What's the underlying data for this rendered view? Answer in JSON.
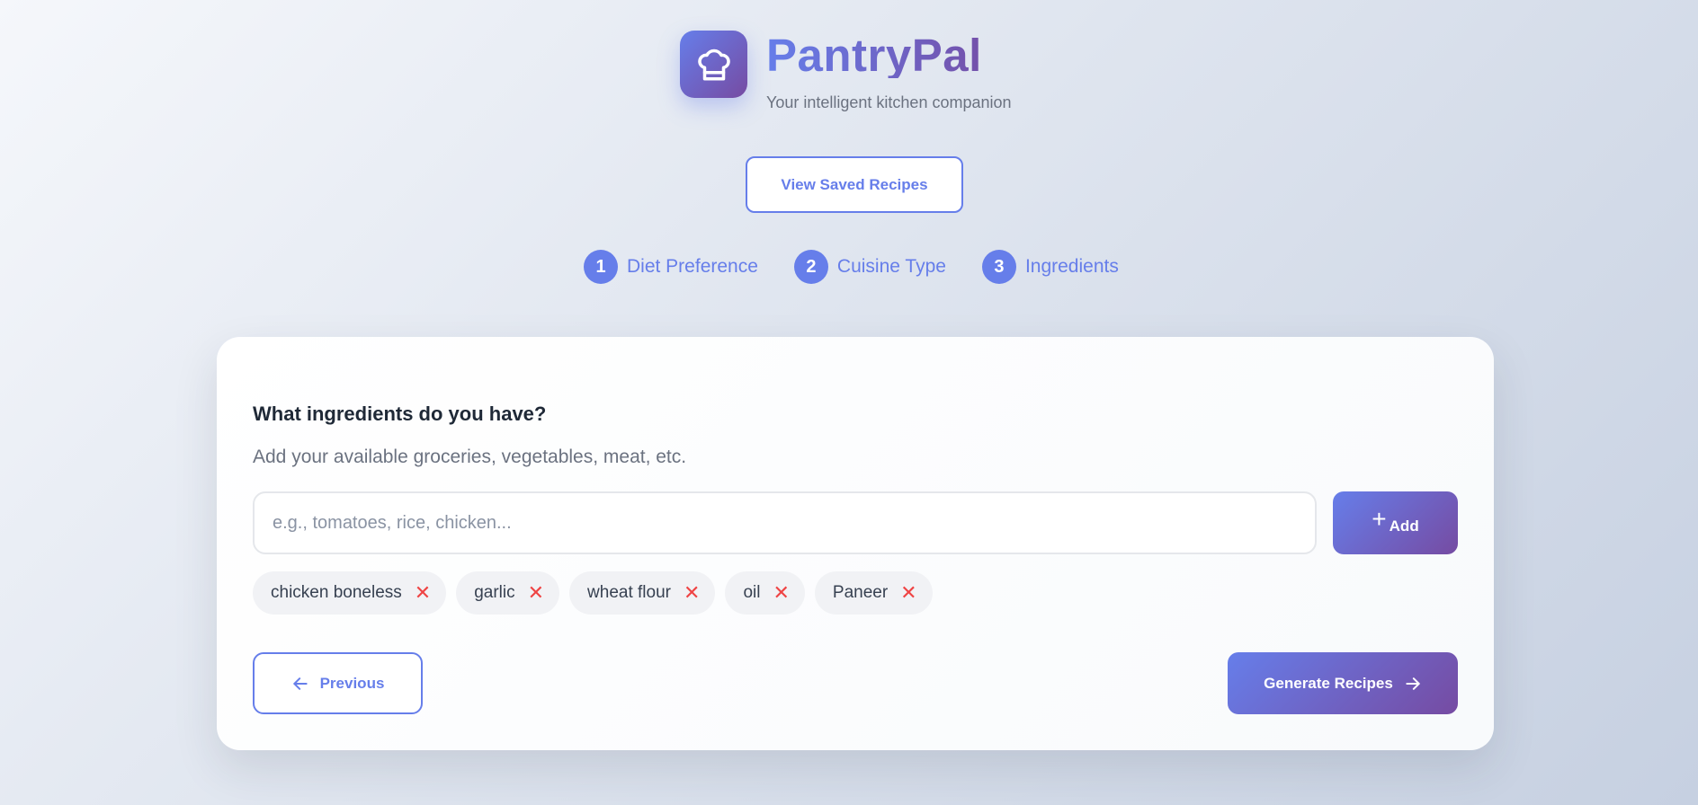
{
  "brand": {
    "title": "PantryPal",
    "subtitle": "Your intelligent kitchen companion",
    "logo_icon": "chef-hat-icon"
  },
  "saved_button": {
    "label": "View Saved Recipes"
  },
  "steps": [
    {
      "number": "1",
      "label": "Diet Preference"
    },
    {
      "number": "2",
      "label": "Cuisine Type"
    },
    {
      "number": "3",
      "label": "Ingredients"
    }
  ],
  "ingredients_step": {
    "title": "What ingredients do you have?",
    "subtitle": "Add your available groceries, vegetables, meat, etc.",
    "input_value": "",
    "input_placeholder": "e.g., tomatoes, rice, chicken...",
    "add_label": "Add",
    "chips": [
      {
        "label": "chicken boneless"
      },
      {
        "label": "garlic"
      },
      {
        "label": "wheat flour"
      },
      {
        "label": "oil"
      },
      {
        "label": "Paneer"
      }
    ]
  },
  "nav": {
    "previous_label": "Previous",
    "generate_label": "Generate Recipes"
  },
  "colors": {
    "accent": "#667eea",
    "accent_end": "#764ba2",
    "remove": "#ef4444"
  }
}
